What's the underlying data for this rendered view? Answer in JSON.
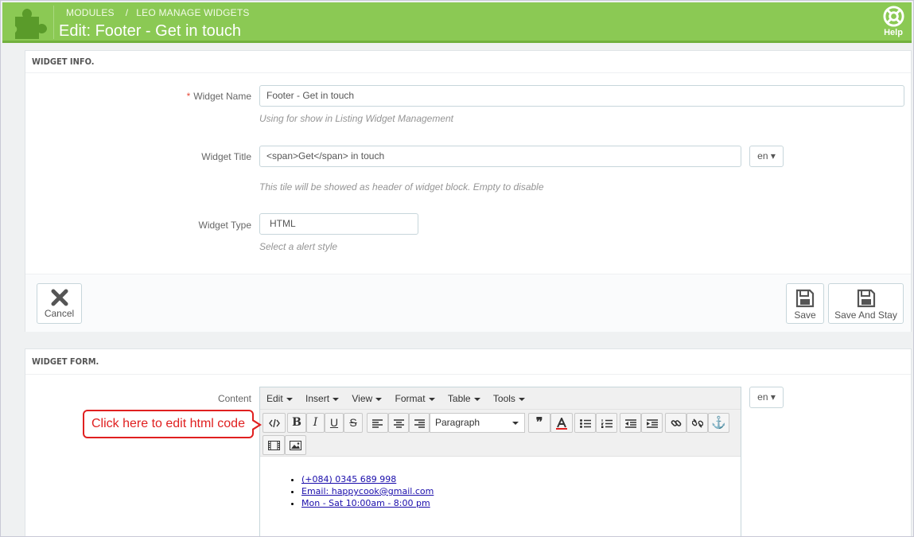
{
  "header": {
    "breadcrumb": [
      "Modules",
      "Leo Manage Widgets"
    ],
    "title": "Edit: Footer - Get in touch",
    "help_label": "Help"
  },
  "widget_info": {
    "heading": "Widget Info.",
    "name_label": "Widget Name",
    "name_value": "Footer - Get in touch",
    "name_hint": "Using for show in Listing Widget Management",
    "title_label": "Widget Title",
    "title_value": "<span>Get</span> in touch",
    "title_lang": "en",
    "title_hint": "This tile will be showed as header of widget block. Empty to disable",
    "type_label": "Widget Type",
    "type_value": "HTML",
    "type_hint": "Select a alert style",
    "cancel_label": "Cancel",
    "save_label": "Save",
    "save_stay_label": "Save And Stay"
  },
  "widget_form": {
    "heading": "Widget Form.",
    "content_label": "Content",
    "content_lang": "en",
    "menu": [
      "Edit",
      "Insert",
      "View",
      "Format",
      "Table",
      "Tools"
    ],
    "format_select": "Paragraph",
    "toolbar_icons": [
      "source-code-icon",
      "bold-icon",
      "italic-icon",
      "underline-icon",
      "strikethrough-icon",
      "align-left-icon",
      "align-center-icon",
      "align-right-icon",
      "blockquote-icon",
      "text-color-icon",
      "bullet-list-icon",
      "numbered-list-icon",
      "outdent-icon",
      "indent-icon",
      "link-icon",
      "unlink-icon",
      "anchor-icon",
      "media-icon",
      "image-icon"
    ],
    "content_items": [
      " (+084) 0345 689 998",
      " Email: happycook@gmail.com",
      " Mon - Sat 10:00am - 8:00 pm"
    ]
  },
  "callout": {
    "text": "Click here to edit html code"
  },
  "colors": {
    "header_green": "#8bc954",
    "callout_red": "#e02020",
    "link_blue": "#1a0dab"
  }
}
